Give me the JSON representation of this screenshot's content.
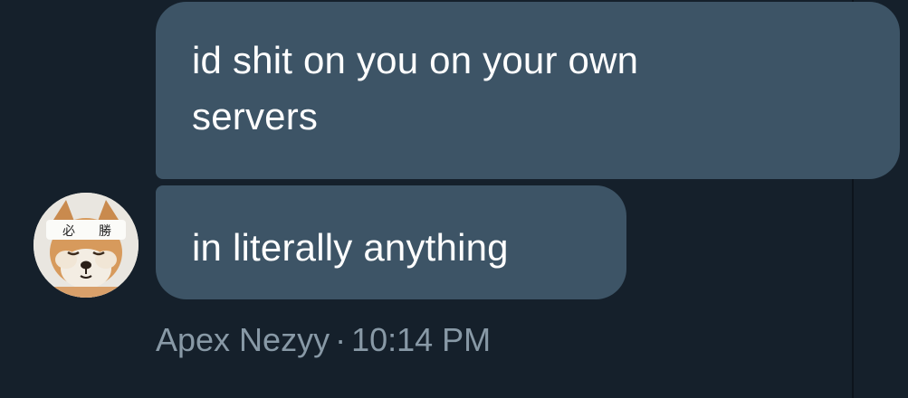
{
  "conversation": {
    "messages": [
      {
        "text": "id shit on you on your own\nservers"
      },
      {
        "text": "in literally anything"
      }
    ],
    "sender": {
      "name": "Apex Nezyy",
      "separator": "·",
      "time": "10:14 PM",
      "avatar_icon": "shiba-dog-headband-avatar"
    }
  },
  "colors": {
    "background": "#15202b",
    "bubble": "#3d5466",
    "bubble_text": "#ffffff",
    "meta_text": "#8899a6"
  }
}
